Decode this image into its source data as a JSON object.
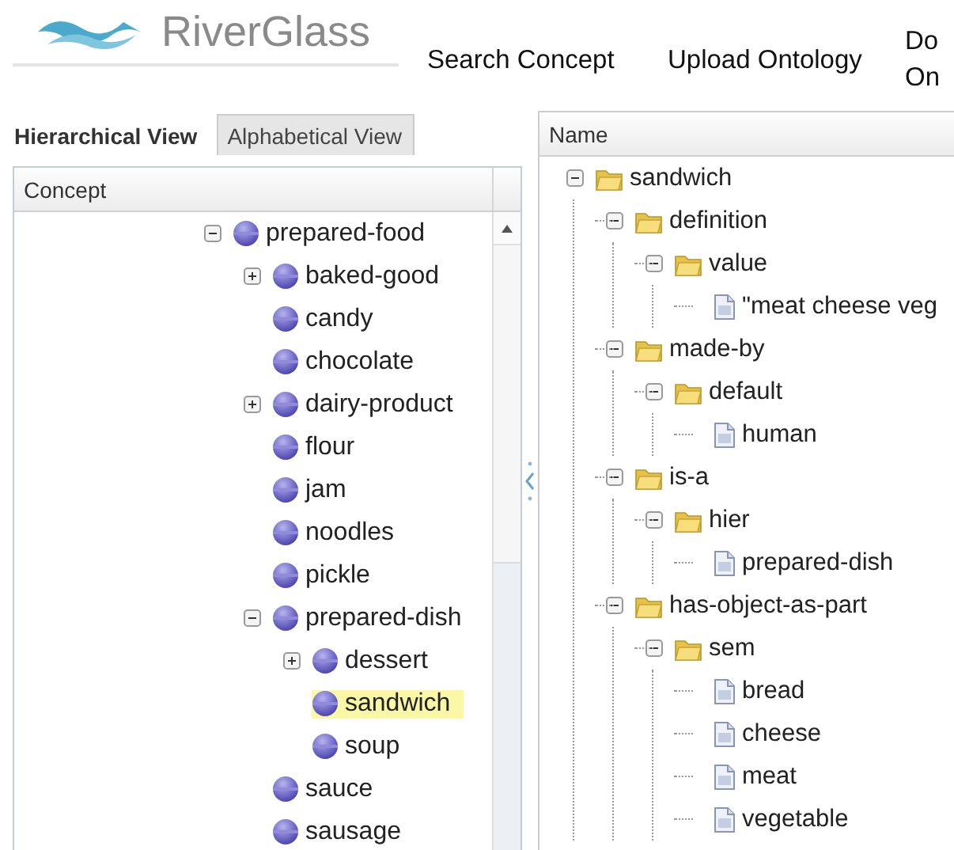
{
  "header": {
    "logo_text": "RiverGlass",
    "nav": [
      {
        "lines": [
          "Search Concept"
        ]
      },
      {
        "lines": [
          "Upload Ontology"
        ]
      },
      {
        "lines": [
          "Do",
          "On"
        ]
      }
    ]
  },
  "left_panel": {
    "tabs": [
      {
        "label": "Hierarchical View",
        "selected": true
      },
      {
        "label": "Alphabetical View",
        "selected": false
      }
    ],
    "column": "Concept",
    "tree": [
      {
        "label": "prepared-food",
        "kind": "branch",
        "expanded": true,
        "selected": false,
        "children": [
          {
            "label": "baked-good",
            "kind": "branch",
            "expanded": false,
            "selected": false
          },
          {
            "label": "candy",
            "kind": "leaf",
            "selected": false
          },
          {
            "label": "chocolate",
            "kind": "leaf",
            "selected": false
          },
          {
            "label": "dairy-product",
            "kind": "branch",
            "expanded": false,
            "selected": false
          },
          {
            "label": "flour",
            "kind": "leaf",
            "selected": false
          },
          {
            "label": "jam",
            "kind": "leaf",
            "selected": false
          },
          {
            "label": "noodles",
            "kind": "leaf",
            "selected": false
          },
          {
            "label": "pickle",
            "kind": "leaf",
            "selected": false
          },
          {
            "label": "prepared-dish",
            "kind": "branch",
            "expanded": true,
            "selected": false,
            "children": [
              {
                "label": "dessert",
                "kind": "branch",
                "expanded": false,
                "selected": false
              },
              {
                "label": "sandwich",
                "kind": "leaf",
                "selected": true
              },
              {
                "label": "soup",
                "kind": "leaf",
                "selected": false
              }
            ]
          },
          {
            "label": "sauce",
            "kind": "leaf",
            "selected": false
          },
          {
            "label": "sausage",
            "kind": "leaf",
            "selected": false
          }
        ]
      }
    ]
  },
  "right_panel": {
    "column": "Name",
    "tree": [
      {
        "label": "sandwich",
        "kind": "folder",
        "expanded": true,
        "children": [
          {
            "label": "definition",
            "kind": "folder",
            "expanded": true,
            "children": [
              {
                "label": "value",
                "kind": "folder",
                "expanded": true,
                "children": [
                  {
                    "label": "\"meat cheese veg",
                    "kind": "document"
                  }
                ]
              }
            ]
          },
          {
            "label": "made-by",
            "kind": "folder",
            "expanded": true,
            "children": [
              {
                "label": "default",
                "kind": "folder",
                "expanded": true,
                "children": [
                  {
                    "label": "human",
                    "kind": "document"
                  }
                ]
              }
            ]
          },
          {
            "label": "is-a",
            "kind": "folder",
            "expanded": true,
            "children": [
              {
                "label": "hier",
                "kind": "folder",
                "expanded": true,
                "children": [
                  {
                    "label": "prepared-dish",
                    "kind": "document"
                  }
                ]
              }
            ]
          },
          {
            "label": "has-object-as-part",
            "kind": "folder",
            "expanded": true,
            "children": [
              {
                "label": "sem",
                "kind": "folder",
                "expanded": true,
                "children": [
                  {
                    "label": "bread",
                    "kind": "document"
                  },
                  {
                    "label": "cheese",
                    "kind": "document"
                  },
                  {
                    "label": "meat",
                    "kind": "document"
                  },
                  {
                    "label": "vegetable",
                    "kind": "document"
                  }
                ]
              }
            ]
          }
        ]
      }
    ]
  }
}
